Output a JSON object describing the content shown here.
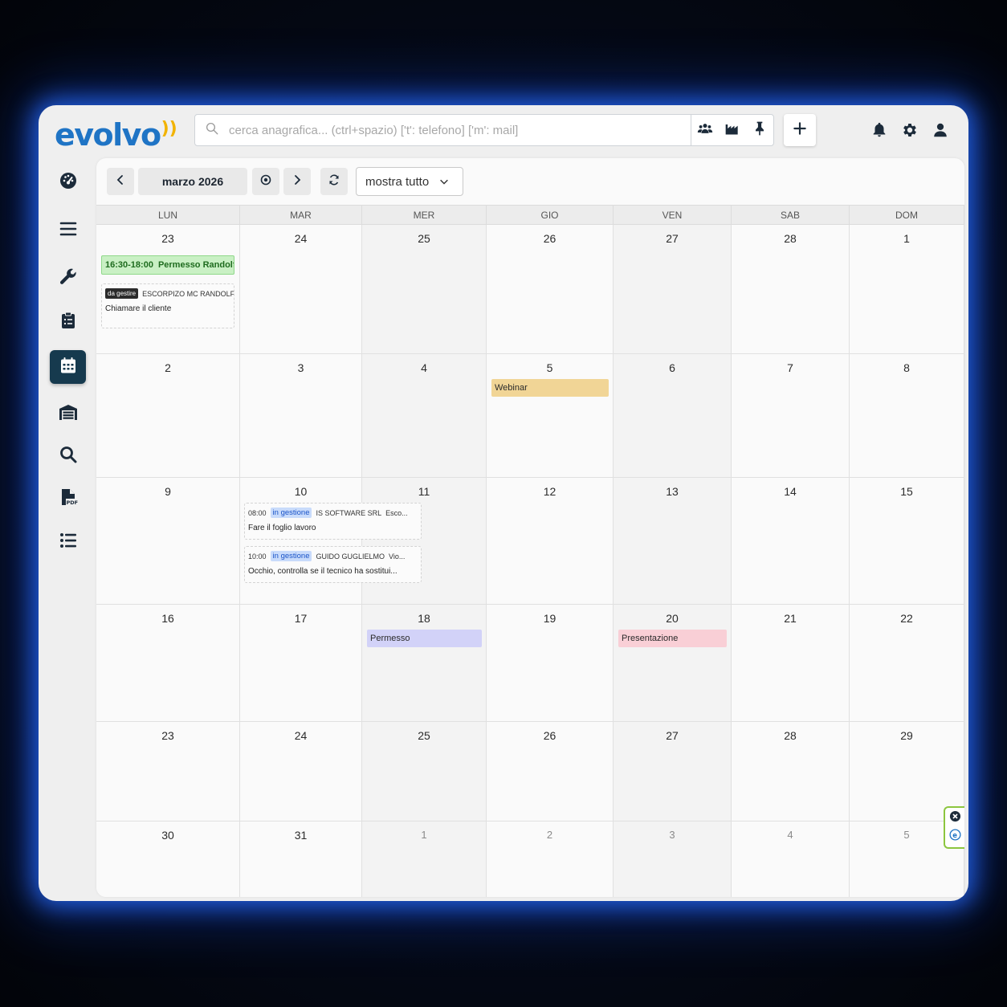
{
  "app": {
    "logo_text": "evolvo",
    "logo_mark": "))"
  },
  "search": {
    "placeholder": "cerca anagrafica... (ctrl+spazio) ['t': telefono] ['m': mail]",
    "value": ""
  },
  "header_tools": [
    {
      "icon": "people-icon"
    },
    {
      "icon": "factory-icon"
    },
    {
      "icon": "pin-icon"
    }
  ],
  "header_right": [
    {
      "icon": "bell-icon"
    },
    {
      "icon": "gear-icon"
    },
    {
      "icon": "user-icon"
    }
  ],
  "sidebar": {
    "items": [
      {
        "name": "dashboard",
        "icon": "dashboard-icon"
      },
      {
        "name": "menu",
        "icon": "menu-icon"
      },
      {
        "name": "tools",
        "icon": "wrench-icon"
      },
      {
        "name": "tasks",
        "icon": "clipboard-icon"
      },
      {
        "name": "calendar",
        "icon": "calendar-icon",
        "active": true
      },
      {
        "name": "warehouse",
        "icon": "warehouse-icon"
      },
      {
        "name": "search",
        "icon": "search-icon"
      },
      {
        "name": "pdf",
        "icon": "pdf-icon"
      },
      {
        "name": "list",
        "icon": "list-icon"
      }
    ]
  },
  "toolbar": {
    "month_label": "marzo 2026",
    "filter_value": "mostra tutto"
  },
  "calendar": {
    "weekdays": [
      "LUN",
      "MAR",
      "MER",
      "GIO",
      "VEN",
      "SAB",
      "DOM"
    ],
    "weeks": [
      [
        {
          "d": "23",
          "cur": true
        },
        {
          "d": "24",
          "cur": true
        },
        {
          "d": "25",
          "cur": true
        },
        {
          "d": "26",
          "cur": true
        },
        {
          "d": "27",
          "cur": true
        },
        {
          "d": "28",
          "cur": true
        },
        {
          "d": "1",
          "cur": true
        }
      ],
      [
        {
          "d": "2",
          "cur": true
        },
        {
          "d": "3",
          "cur": true
        },
        {
          "d": "4",
          "cur": true
        },
        {
          "d": "5",
          "cur": true
        },
        {
          "d": "6",
          "cur": true
        },
        {
          "d": "7",
          "cur": true
        },
        {
          "d": "8",
          "cur": true
        }
      ],
      [
        {
          "d": "9",
          "cur": true
        },
        {
          "d": "10",
          "cur": true
        },
        {
          "d": "11",
          "cur": true
        },
        {
          "d": "12",
          "cur": true
        },
        {
          "d": "13",
          "cur": true
        },
        {
          "d": "14",
          "cur": true
        },
        {
          "d": "15",
          "cur": true
        }
      ],
      [
        {
          "d": "16",
          "cur": true
        },
        {
          "d": "17",
          "cur": true
        },
        {
          "d": "18",
          "cur": true
        },
        {
          "d": "19",
          "cur": true
        },
        {
          "d": "20",
          "cur": true
        },
        {
          "d": "21",
          "cur": true
        },
        {
          "d": "22",
          "cur": true
        }
      ],
      [
        {
          "d": "23",
          "cur": true
        },
        {
          "d": "24",
          "cur": true
        },
        {
          "d": "25",
          "cur": true
        },
        {
          "d": "26",
          "cur": true
        },
        {
          "d": "27",
          "cur": true
        },
        {
          "d": "28",
          "cur": true
        },
        {
          "d": "29",
          "cur": true
        }
      ],
      [
        {
          "d": "30",
          "cur": true
        },
        {
          "d": "31",
          "cur": true
        },
        {
          "d": "1",
          "cur": false
        },
        {
          "d": "2",
          "cur": false
        },
        {
          "d": "3",
          "cur": false
        },
        {
          "d": "4",
          "cur": false
        },
        {
          "d": "5",
          "cur": false
        }
      ]
    ]
  },
  "events": {
    "permesso_randolf": {
      "time": "16:30-18:00",
      "title": "Permesso Randolf",
      "color": "#c9f0c4",
      "text_color": "#1e6b1e"
    },
    "escorpizo": {
      "status": "da gestire",
      "client": "ESCORPIZO MC RANDOLF",
      "note": "Chiamare il cliente"
    },
    "webinar": {
      "title": "Webinar",
      "color": "#f1d596"
    },
    "is_software": {
      "time": "08:00",
      "status": "in gestione",
      "client": "IS SOFTWARE SRL",
      "extra": "Esco...",
      "note": "Fare il foglio lavoro"
    },
    "guido": {
      "time": "10:00",
      "status": "in gestione",
      "client": "GUIDO GUGLIELMO",
      "extra": "Vio...",
      "note": "Occhio, controlla se il tecnico ha sostitui..."
    },
    "permesso": {
      "title": "Permesso",
      "color": "#d2d2f8"
    },
    "presentazione": {
      "title": "Presentazione",
      "color": "#f9cfd6"
    }
  },
  "colors": {
    "accent": "#1f74c5",
    "sidebar_active": "#163a4e",
    "glow": "#2a6bff"
  }
}
